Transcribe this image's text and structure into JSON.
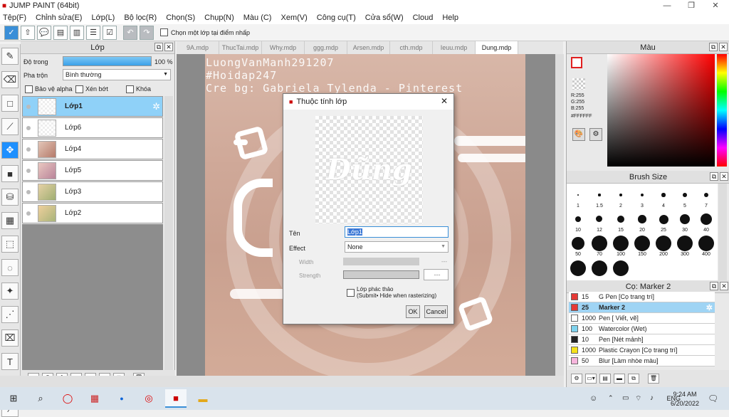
{
  "window": {
    "title": "JUMP PAINT (64bit)",
    "minimize": "—",
    "restore": "❐",
    "close": "✕"
  },
  "menu": [
    "Tệp(F)",
    "Chỉnh sửa(E)",
    "Lớp(L)",
    "Bộ lọc(R)",
    "Chọn(S)",
    "Chụp(N)",
    "Màu (C)",
    "Xem(V)",
    "Công cụ(T)",
    "Cửa sổ(W)",
    "Cloud",
    "Help"
  ],
  "toolbar": {
    "select_layer_label": "Chọn một lớp tại điểm nhấp"
  },
  "layer_panel": {
    "title": "Lớp",
    "opacity_label": "Độ trong",
    "opacity_value": "100 %",
    "opacity_fraction": 1.0,
    "blend_label": "Pha trộn",
    "blend_value": "Bình thường",
    "protect_alpha": "Bảo vệ alpha",
    "clip": "Xén bớt",
    "lock": "Khóa",
    "layers": [
      "Lớp1",
      "Lớp6",
      "Lớp4",
      "Lớp5",
      "Lớp3",
      "Lớp2"
    ]
  },
  "tabs": [
    "9A.mdp",
    "ThucTai.mdp",
    "Why.mdp",
    "ggg.mdp",
    "Arsen.mdp",
    "cth.mdp",
    "Ieuu.mdp",
    "Dung.mdp"
  ],
  "canvas": {
    "watermark_lines": [
      "LuongVanManh291207",
      "#Hoidap247",
      "Cre bg: Gabriela Tylenda -  Pinterest"
    ]
  },
  "dialog": {
    "title": "Thuộc tính lớp",
    "preview_text": "Dũng",
    "name_label": "Tên",
    "name_value": "Lớp1",
    "effect_label": "Effect",
    "effect_value": "None",
    "width_label": "Width",
    "width_value": "---",
    "strength_label": "Strength",
    "strength_value": "---",
    "sketch_label": "Lớp phác thảo",
    "sketch_note": "(Submit• Hide when rasterizing)",
    "ok": "OK",
    "cancel": "Cancel"
  },
  "color_panel": {
    "title": "Màu",
    "r": "R:255",
    "g": "G:255",
    "b": "B:255",
    "hex": "#FFFFFF"
  },
  "brush_size": {
    "title": "Brush Size",
    "sizes": [
      "1",
      "1.5",
      "2",
      "3",
      "4",
      "5",
      "7",
      "10",
      "12",
      "15",
      "20",
      "25",
      "30",
      "40",
      "50",
      "70",
      "100",
      "150",
      "200",
      "300",
      "400"
    ]
  },
  "brush_panel": {
    "title": "Cọ: Marker 2",
    "brushes": [
      {
        "size": "15",
        "name": "G Pen [Cọ trang trí]",
        "color": "#e53935"
      },
      {
        "size": "25",
        "name": "Marker 2",
        "color": "#e53935"
      },
      {
        "size": "1000",
        "name": "Pen [ Viết, vẽ]",
        "color": "#ffffff"
      },
      {
        "size": "100",
        "name": "Watercolor (Wet)",
        "color": "#7fd3ee"
      },
      {
        "size": "10",
        "name": "Pen [Nét mảnh]",
        "color": "#222222"
      },
      {
        "size": "1000",
        "name": "Plastic Crayon [Cọ trang trí]",
        "color": "#f5e11b"
      },
      {
        "size": "50",
        "name": "Blur [Làm nhòe màu]",
        "color": "#f7b5dd"
      }
    ]
  },
  "taskbar": {
    "time": "9:24 AM",
    "date": "6/20/2022",
    "lang": "ENG"
  }
}
